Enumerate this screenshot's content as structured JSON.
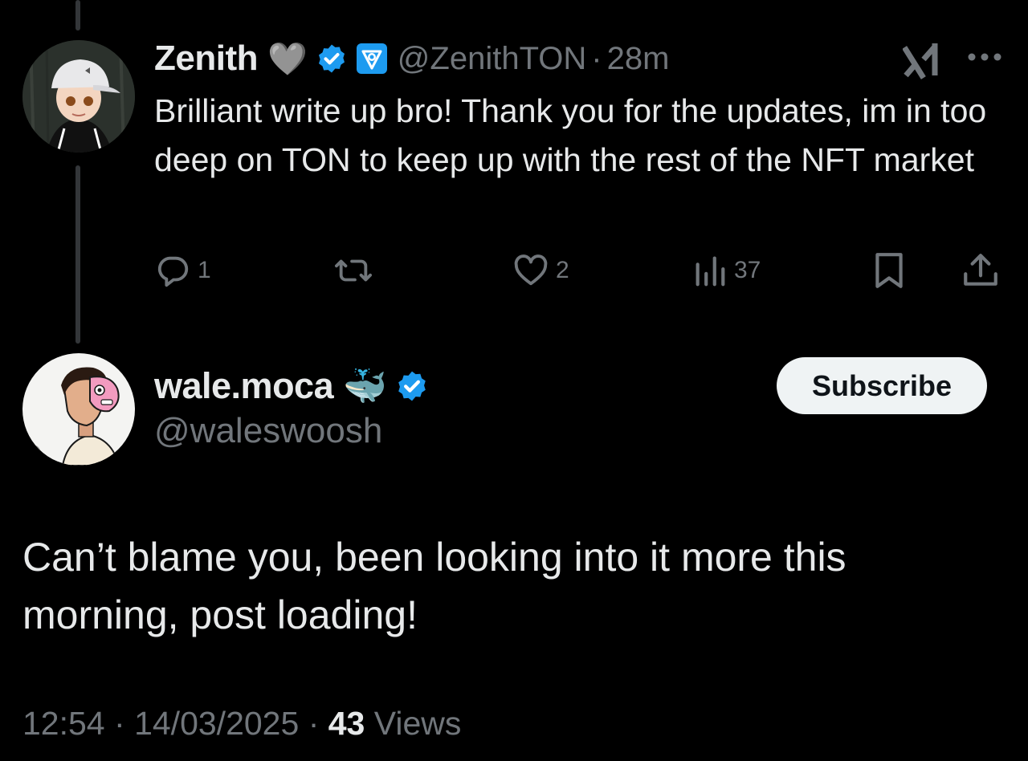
{
  "reply": {
    "display_name": "Zenith",
    "name_emoji": "🩶",
    "handle": "@ZenithTON",
    "separator": "·",
    "time": "28m",
    "text": "Brilliant write up bro! Thank you for the updates, im in too deep on TON to keep up with the rest of the NFT market",
    "actions": {
      "reply_count": "1",
      "retweet_count": "",
      "like_count": "2",
      "views_count": "37"
    },
    "icons": {
      "avatar": "avatar-cartoon-cap",
      "verified": "verified-badge-icon",
      "affiliate": "ton-affiliate-icon",
      "grok": "grok-icon",
      "more": "more-icon",
      "reply": "reply-icon",
      "retweet": "retweet-icon",
      "like": "heart-icon",
      "views": "views-icon",
      "bookmark": "bookmark-icon",
      "share": "share-icon"
    }
  },
  "main": {
    "display_name": "wale.moca",
    "name_emoji": "🐳",
    "handle": "@waleswoosh",
    "subscribe_label": "Subscribe",
    "text": "Can’t blame you, been looking into it more this morning, post loading!",
    "time": "12:54",
    "sep1": "·",
    "date": "14/03/2025",
    "sep2": "·",
    "views_count": "43",
    "views_label": "Views"
  },
  "colors": {
    "background": "#000000",
    "text_primary": "#e7e9ea",
    "text_secondary": "#71767b",
    "verified_blue": "#1d9bf0",
    "thread_line": "#333639",
    "button_bg": "#eff3f4"
  }
}
